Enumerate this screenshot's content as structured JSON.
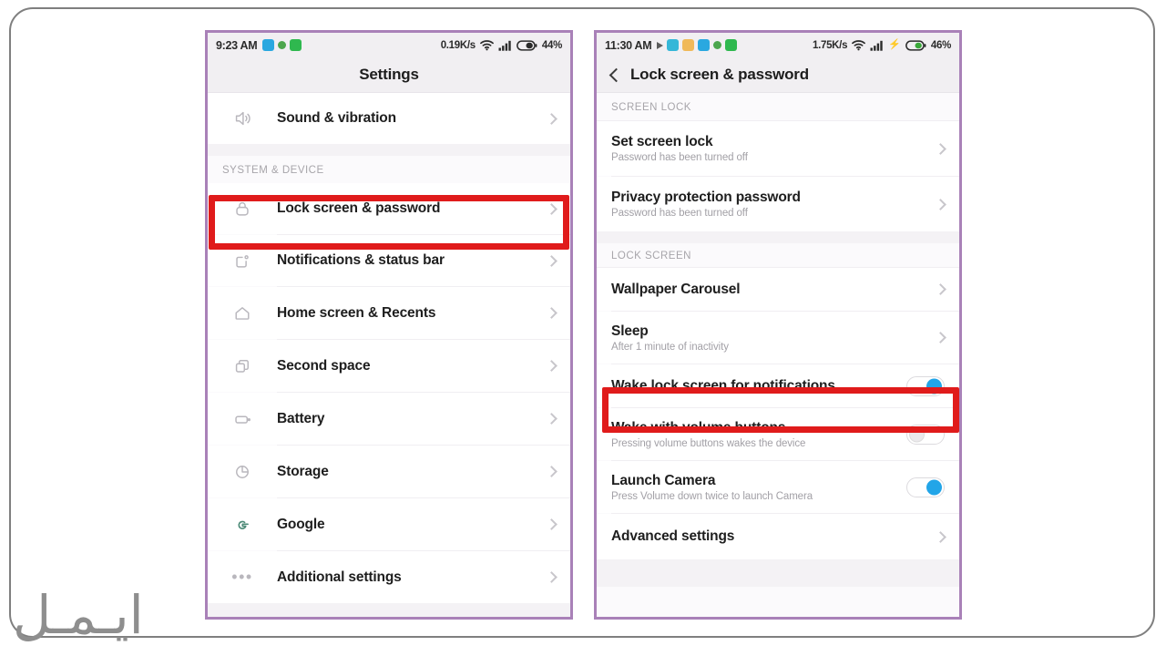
{
  "watermark": {
    "text": "ایـمـل"
  },
  "colors": {
    "highlight": "#e01b1b",
    "phone_border": "#a981b8",
    "toggle_on": "#22a5e8",
    "frame": "#7f7f7f"
  },
  "left_phone": {
    "statusbar": {
      "time": "9:23 AM",
      "data_rate": "0.19K/s",
      "battery_percent": "44%",
      "left_icons": [
        "app-square-blue-icon",
        "dot-green-icon",
        "whatsapp-green-icon"
      ],
      "right_icons": [
        "wifi-icon",
        "signal-bars-icon",
        "battery-icon"
      ]
    },
    "title": "Settings",
    "items": [
      {
        "icon": "sound-icon",
        "label": "Sound & vibration",
        "sub": "",
        "control": "chevron"
      },
      {
        "icon": "lock-icon",
        "label": "Lock screen & password",
        "sub": "",
        "control": "chevron",
        "highlighted": true
      },
      {
        "icon": "notifications-icon",
        "label": "Notifications & status bar",
        "sub": "",
        "control": "chevron"
      },
      {
        "icon": "home-icon",
        "label": "Home screen & Recents",
        "sub": "",
        "control": "chevron"
      },
      {
        "icon": "second-space-icon",
        "label": "Second space",
        "sub": "",
        "control": "chevron"
      },
      {
        "icon": "battery-icon",
        "label": "Battery",
        "sub": "",
        "control": "chevron"
      },
      {
        "icon": "storage-icon",
        "label": "Storage",
        "sub": "",
        "control": "chevron"
      },
      {
        "icon": "google-icon",
        "label": "Google",
        "sub": "",
        "control": "chevron"
      },
      {
        "icon": "more-icon",
        "label": "Additional settings",
        "sub": "",
        "control": "chevron"
      }
    ],
    "section_label": "SYSTEM & DEVICE"
  },
  "right_phone": {
    "statusbar": {
      "time": "11:30 AM",
      "data_rate": "1.75K/s",
      "battery_percent": "46%",
      "left_icons": [
        "play-icon",
        "app-cyan-icon",
        "app-orange-icon",
        "app-blue-icon",
        "dot-green-icon",
        "whatsapp-green-icon"
      ],
      "right_icons": [
        "wifi-icon",
        "signal-bars-icon",
        "charging-bolt-icon",
        "battery-icon"
      ]
    },
    "title": "Lock screen & password",
    "back_icon": "back-chevron-icon",
    "sections": [
      {
        "label": "SCREEN LOCK",
        "items": [
          {
            "label": "Set screen lock",
            "sub": "Password has been turned off",
            "control": "chevron"
          },
          {
            "label": "Privacy protection password",
            "sub": "Password has been turned off",
            "control": "chevron"
          }
        ]
      },
      {
        "label": "LOCK SCREEN",
        "items": [
          {
            "label": "Wallpaper Carousel",
            "sub": "",
            "control": "chevron"
          },
          {
            "label": "Sleep",
            "sub": "After 1 minute of inactivity",
            "control": "chevron"
          },
          {
            "label": "Wake lock screen for notifications",
            "sub": "",
            "control": "toggle",
            "toggle_on": true,
            "highlighted": true
          },
          {
            "label": "Wake with volume buttons",
            "sub": "Pressing volume buttons wakes the device",
            "control": "toggle",
            "toggle_on": false
          },
          {
            "label": "Launch Camera",
            "sub": "Press Volume down twice to launch Camera",
            "control": "toggle",
            "toggle_on": true
          },
          {
            "label": "Advanced settings",
            "sub": "",
            "control": "chevron"
          }
        ]
      }
    ]
  }
}
